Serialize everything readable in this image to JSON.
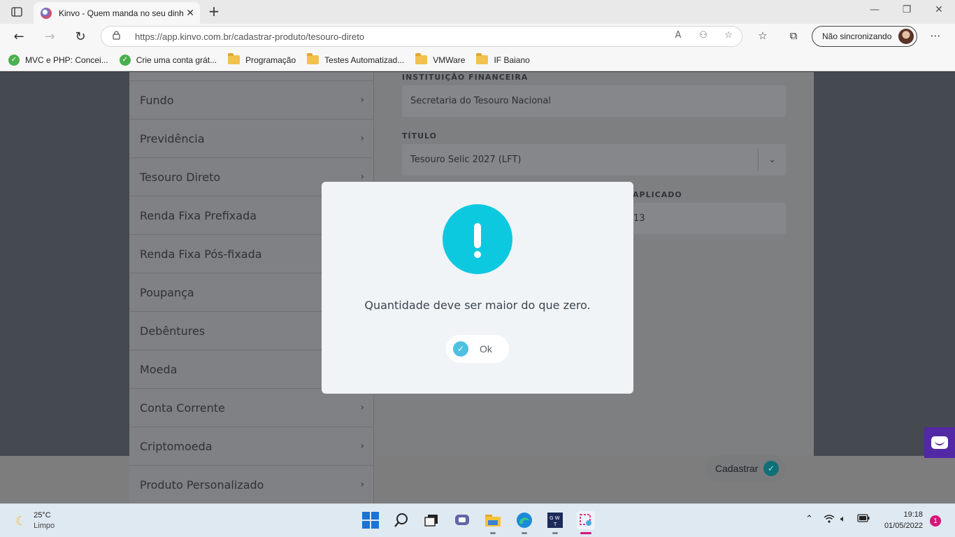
{
  "browser": {
    "tab_title": "Kinvo - Quem manda no seu dinheiro",
    "url": "https://app.kinvo.com.br/cadastrar-produto/tesouro-direto",
    "sync_label": "Não sincronizando",
    "bookmarks": [
      {
        "label": "MVC e PHP: Concei...",
        "icon": "globe-icon"
      },
      {
        "label": "Crie uma conta grát...",
        "icon": "globe-icon"
      },
      {
        "label": "Programação",
        "icon": "folder-icon"
      },
      {
        "label": "Testes Automatizad...",
        "icon": "folder-icon"
      },
      {
        "label": "VMWare",
        "icon": "folder-icon"
      },
      {
        "label": "IF Baiano",
        "icon": "folder-icon"
      }
    ]
  },
  "sidebar": {
    "items": [
      {
        "label": "Fundo",
        "has_chevron": true
      },
      {
        "label": "Previdência",
        "has_chevron": true
      },
      {
        "label": "Tesouro Direto",
        "has_chevron": true
      },
      {
        "label": "Renda Fixa Prefixada",
        "has_chevron": false
      },
      {
        "label": "Renda Fixa Pós-fixada",
        "has_chevron": false
      },
      {
        "label": "Poupança",
        "has_chevron": false
      },
      {
        "label": "Debêntures",
        "has_chevron": false
      },
      {
        "label": "Moeda",
        "has_chevron": false
      },
      {
        "label": "Conta Corrente",
        "has_chevron": true
      },
      {
        "label": "Criptomoeda",
        "has_chevron": true
      },
      {
        "label": "Produto Personalizado",
        "has_chevron": true
      }
    ]
  },
  "form": {
    "institution_label": "INSTITUIÇÃO FINANCEIRA",
    "institution_value": "Secretaria do Tesouro Nacional",
    "title_label": "TÍTULO",
    "title_value": "Tesouro Selic 2027 (LFT)",
    "partial_label": "APLICADO",
    "partial_value": "13",
    "submit_label": "Cadastrar"
  },
  "modal": {
    "message": "Quantidade deve ser maior do que zero.",
    "ok_label": "Ok",
    "icon": "exclamation-icon",
    "accent_color": "#0cc9e0"
  },
  "taskbar": {
    "temperature": "25°C",
    "weather": "Limpo",
    "time": "19:18",
    "date": "01/05/2022",
    "notification_count": "1"
  }
}
